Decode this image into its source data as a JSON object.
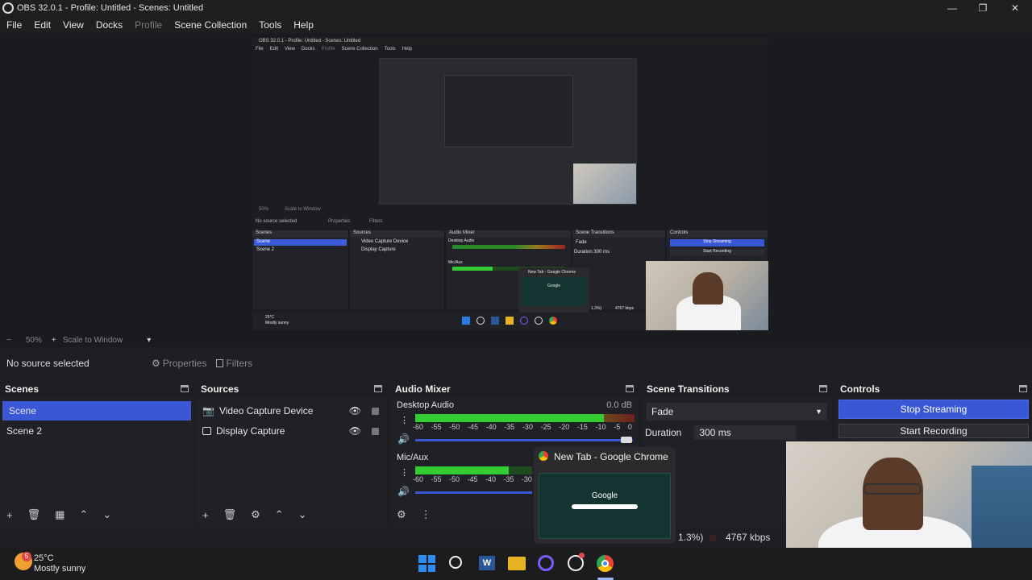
{
  "window": {
    "title": "OBS 32.0.1 - Profile: Untitled - Scenes: Untitled",
    "minimize": "—",
    "maximize": "❐",
    "close": "✕"
  },
  "menu": [
    "File",
    "Edit",
    "View",
    "Docks",
    "Profile",
    "Scene Collection",
    "Tools",
    "Help"
  ],
  "nested_preview": {
    "title": "OBS 32.0.1 - Profile: Untitled - Scenes: Untitled",
    "menu": [
      "File",
      "Edit",
      "View",
      "Docks",
      "Profile",
      "Scene Collection",
      "Tools",
      "Help"
    ],
    "no_source": "No source selected",
    "properties": "Properties",
    "filters": "Filters",
    "scenes_title": "Scenes",
    "scenes": [
      "Scene",
      "Scene 2"
    ],
    "sources_title": "Sources",
    "sources": [
      "Video Capture Device",
      "Display Capture"
    ],
    "mixer_title": "Audio Mixer",
    "transitions_title": "Scene Transitions",
    "controls_title": "Controls",
    "stop_streaming": "Stop Streaming",
    "start_recording": "Start Recording",
    "fade": "Fade",
    "duration": "Duration",
    "duration_value": "300 ms",
    "desktop_audio": "Desktop Audio",
    "mic": "Mic/Aux",
    "chrome_tab": "New Tab - Google Chrome",
    "google": "Google",
    "bitrate": "4767 kbps",
    "cpu": "1.3%)",
    "weather_temp": "25°C",
    "weather_desc": "Mostly sunny",
    "zoom": "50%",
    "scale": "Scale to Window"
  },
  "zoom_bar": {
    "zoom_minus": "−",
    "zoom_value": "50%",
    "zoom_plus": "+",
    "scale_mode": "Scale to Window",
    "dropdown": "▾"
  },
  "source_bar": {
    "no_source": "No source selected",
    "properties": "Properties",
    "filters": "Filters"
  },
  "scenes": {
    "title": "Scenes",
    "items": [
      "Scene",
      "Scene 2"
    ],
    "selected_index": 0
  },
  "sources": {
    "title": "Sources",
    "items": [
      {
        "name": "Video Capture Device",
        "icon": "camera-icon"
      },
      {
        "name": "Display Capture",
        "icon": "monitor-icon"
      }
    ]
  },
  "audio_mixer": {
    "title": "Audio Mixer",
    "channels": [
      {
        "name": "Desktop Audio",
        "db": "0.0 dB",
        "level": 0.86
      },
      {
        "name": "Mic/Aux",
        "db": "",
        "level": 0.4
      }
    ],
    "ticks": [
      "-60",
      "-55",
      "-50",
      "-45",
      "-40",
      "-35",
      "-30",
      "-25",
      "-20",
      "-15",
      "-10",
      "-5",
      "0"
    ],
    "ticks_mic": [
      "-60",
      "-55",
      "-50",
      "-45",
      "-40",
      "-35",
      "-30"
    ]
  },
  "transitions": {
    "title": "Scene Transitions",
    "selected": "Fade",
    "duration_label": "Duration",
    "duration_value": "300 ms"
  },
  "controls": {
    "title": "Controls",
    "stop_streaming": "Stop Streaming",
    "start_recording": "Start Recording"
  },
  "status": {
    "cpu": "1.3%)",
    "bitrate": "4767 kbps"
  },
  "chrome_popup": {
    "title": "New Tab - Google Chrome",
    "google": "Google"
  },
  "taskbar": {
    "weather_temp": "25°C",
    "weather_desc": "Mostly sunny",
    "weather_badge": "5"
  },
  "colors": {
    "accent": "#3a58d6",
    "meter_green": "#33cc33",
    "meter_yellow": "#c9a227",
    "meter_red": "#c0392b"
  }
}
